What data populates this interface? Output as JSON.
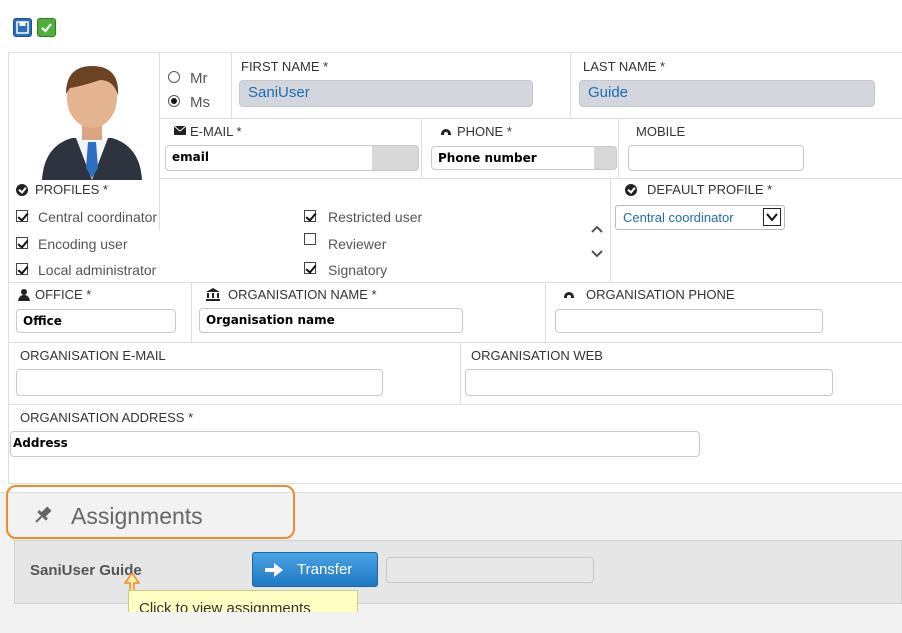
{
  "toolbar": {
    "save_icon": "save-icon",
    "confirm_icon": "check-icon"
  },
  "form": {
    "salutation": {
      "options": [
        "Mr",
        "Ms"
      ],
      "selected": "Ms"
    },
    "first_name": {
      "label": "FIRST NAME *",
      "value": "SaniUser"
    },
    "last_name": {
      "label": "LAST NAME *",
      "value": "Guide"
    },
    "email": {
      "label": "E-MAIL *",
      "value": "email"
    },
    "phone": {
      "label": "PHONE *",
      "value": "Phone number"
    },
    "mobile": {
      "label": "MOBILE",
      "value": ""
    },
    "profiles": {
      "label": "PROFILES *",
      "items": [
        {
          "label": "Central coordinator",
          "checked": true
        },
        {
          "label": "Encoding user",
          "checked": true
        },
        {
          "label": "Local administrator",
          "checked": true
        },
        {
          "label": "Restricted user",
          "checked": true
        },
        {
          "label": "Reviewer",
          "checked": false
        },
        {
          "label": "Signatory",
          "checked": true
        }
      ]
    },
    "default_profile": {
      "label": "DEFAULT PROFILE *",
      "value": "Central coordinator"
    },
    "office": {
      "label": "OFFICE *",
      "value": "Office"
    },
    "org_name": {
      "label": "ORGANISATION NAME *",
      "value": "Organisation name"
    },
    "org_phone": {
      "label": "ORGANISATION PHONE",
      "value": ""
    },
    "org_email": {
      "label": "ORGANISATION E-MAIL",
      "value": ""
    },
    "org_web": {
      "label": "ORGANISATION WEB",
      "value": ""
    },
    "org_address": {
      "label": "ORGANISATION ADDRESS *",
      "value": "Address"
    }
  },
  "assignments": {
    "title": "Assignments",
    "user": "SaniUser Guide",
    "transfer_label": "Transfer",
    "tooltip": "Click to view assignments"
  },
  "colors": {
    "accent": "#1c6db5",
    "button": "#2b8bd6",
    "highlight": "#f08a28",
    "tooltip_bg": "#ffffc4"
  }
}
